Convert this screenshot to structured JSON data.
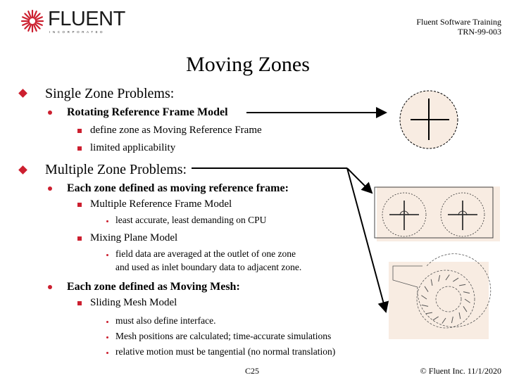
{
  "logo": {
    "name": "FLUENT",
    "tagline": "INCORPORATED",
    "brand_color": "#cc1f2f"
  },
  "header": {
    "line1": "Fluent Software Training",
    "line2": "TRN-99-003"
  },
  "title": "Moving Zones",
  "outline": [
    {
      "text": "Single Zone Problems:",
      "children": [
        {
          "text": "Rotating Reference Frame Model",
          "children": [
            {
              "text": "define zone as Moving Reference Frame"
            },
            {
              "text": "limited applicability"
            }
          ]
        }
      ]
    },
    {
      "text": "Multiple Zone Problems:",
      "children": [
        {
          "text": "Each zone defined as moving reference frame:",
          "children": [
            {
              "text": "Multiple Reference Frame Model",
              "children": [
                {
                  "text": "least accurate, least demanding on CPU"
                }
              ]
            },
            {
              "text": "Mixing Plane Model",
              "children": [
                {
                  "text": "field data are averaged at the outlet of one zone"
                },
                {
                  "text": "and used as inlet boundary data to adjacent zone."
                }
              ]
            }
          ]
        },
        {
          "text": "Each zone defined as Moving Mesh:",
          "children": [
            {
              "text": "Sliding Mesh Model",
              "children": [
                {
                  "text": "must also define interface."
                },
                {
                  "text": "Mesh positions are calculated; time-accurate simulations"
                },
                {
                  "text": "relative motion must be tangential (no normal translation)"
                }
              ]
            }
          ]
        }
      ]
    }
  ],
  "figures": {
    "single_zone": "single-rotating-zone-diagram",
    "mrf": "two-rotating-zones-diagram",
    "sliding_mesh": "impeller-volute-diagram",
    "fill_color": "#f8ece2"
  },
  "footer": {
    "page": "C25",
    "copyright": "© Fluent Inc. 11/1/2020"
  }
}
